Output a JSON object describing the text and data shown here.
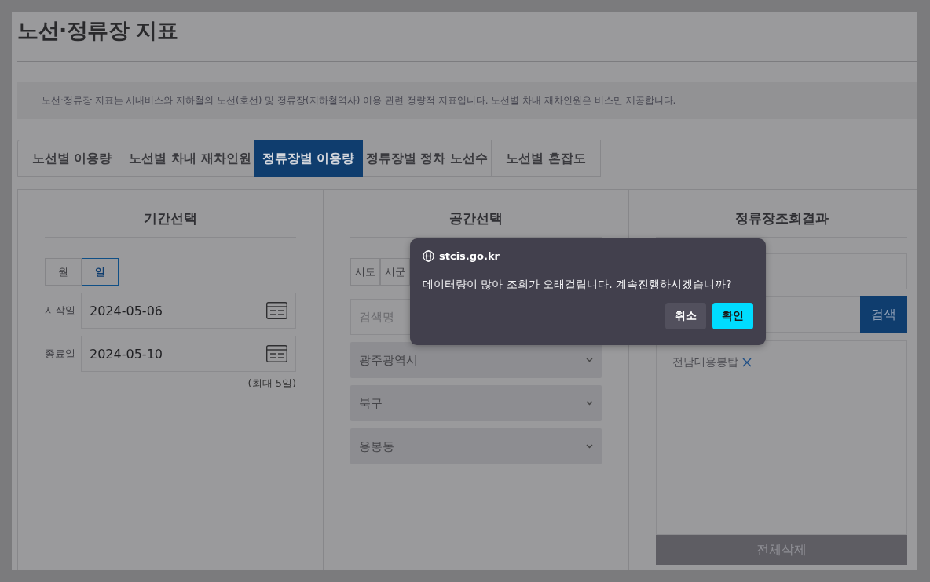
{
  "page": {
    "title": "노선·정류장 지표",
    "description": "노선·정류장 지표는 시내버스와 지하철의 노선(호선) 및 정류장(지하철역사) 이용 관련 정량적 지표입니다. 노선별 차내 재차인원은 버스만 제공합니다."
  },
  "tabs": [
    {
      "label": "노선별 이용량",
      "selected": false
    },
    {
      "label": "노선별 차내 재차인원",
      "selected": false
    },
    {
      "label": "정류장별 이용량",
      "selected": true
    },
    {
      "label": "정류장별 정차 노선수",
      "selected": false
    },
    {
      "label": "노선별 혼잡도",
      "selected": false
    }
  ],
  "period_panel": {
    "title": "기간선택",
    "unit_toggle": [
      {
        "label": "월",
        "selected": false
      },
      {
        "label": "일",
        "selected": true
      }
    ],
    "start_label": "시작일",
    "start_date": "2024-05-06",
    "end_label": "종료일",
    "end_date": "2024-05-10",
    "note": "(최대 5일)"
  },
  "space_panel": {
    "title": "공간선택",
    "level_toggle": [
      {
        "label": "시도",
        "selected": false
      },
      {
        "label": "시군",
        "selected": false
      }
    ],
    "search_placeholder": "검색명",
    "dropdowns": [
      "광주광역시",
      "북구",
      "용봉동"
    ]
  },
  "result_panel": {
    "title": "정류장조회결과",
    "search_button": "검색",
    "selected_stops": [
      "전남대용봉탑"
    ],
    "clear_button": "전체삭제"
  },
  "dialog": {
    "origin": "stcis.go.kr",
    "message": "데이터량이 많아 조회가 오래걸립니다. 계속진행하시겠습니까?",
    "buttons": [
      {
        "label": "취소",
        "kind": "cancel"
      },
      {
        "label": "확인",
        "kind": "confirm"
      }
    ]
  }
}
